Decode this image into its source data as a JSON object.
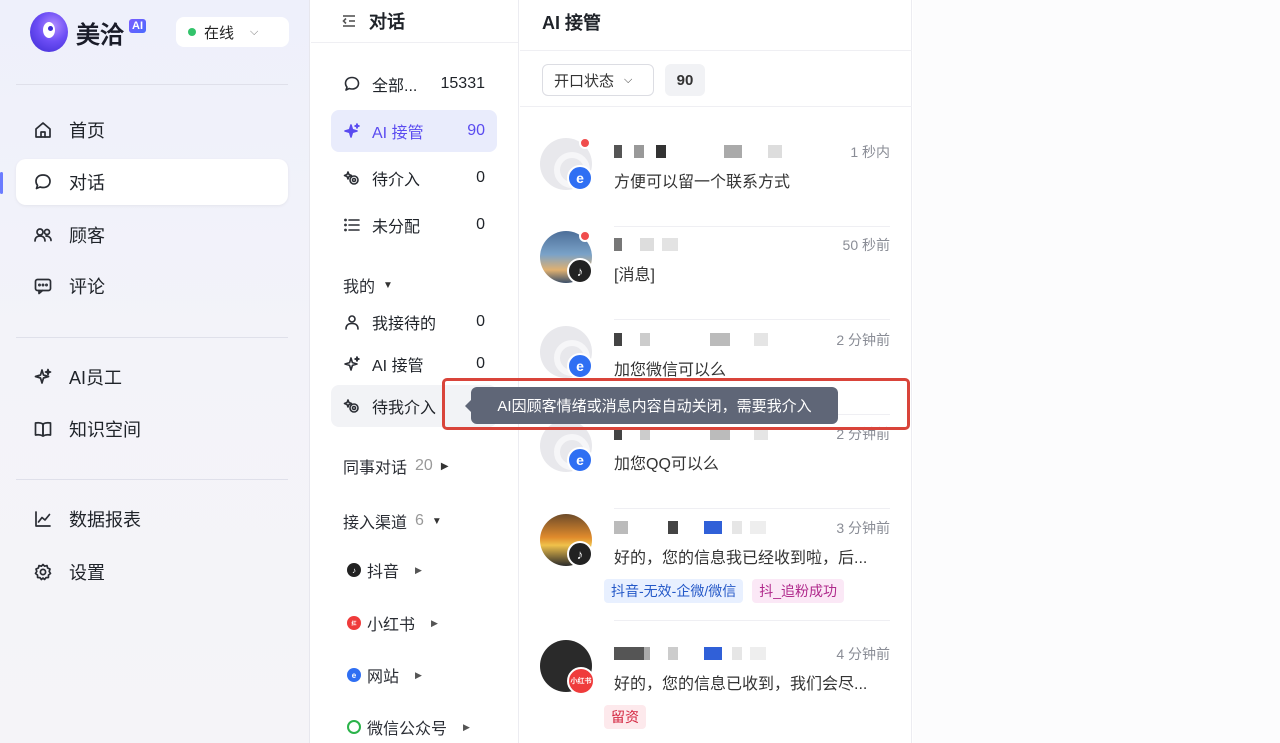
{
  "brand": {
    "name": "美洽",
    "ai_badge": "AI",
    "status": "在线"
  },
  "nav": {
    "items": [
      {
        "label": "首页",
        "icon": "home-icon"
      },
      {
        "label": "对话",
        "icon": "chat-bubble-icon"
      },
      {
        "label": "顾客",
        "icon": "people-icon"
      },
      {
        "label": "评论",
        "icon": "comment-icon"
      },
      {
        "label": "AI员工",
        "icon": "sparkle-icon"
      },
      {
        "label": "知识空间",
        "icon": "book-icon"
      },
      {
        "label": "数据报表",
        "icon": "chart-line-icon"
      },
      {
        "label": "设置",
        "icon": "gear-icon"
      }
    ]
  },
  "conv": {
    "title": "对话",
    "filters": [
      {
        "label": "全部...",
        "count": "15331"
      },
      {
        "label": "AI 接管",
        "count": "90"
      },
      {
        "label": "待介入",
        "count": "0"
      },
      {
        "label": "未分配",
        "count": "0"
      }
    ],
    "mine_label": "我的",
    "mine": [
      {
        "label": "我接待的",
        "count": "0"
      },
      {
        "label": "AI 接管",
        "count": "0"
      },
      {
        "label": "待我介入",
        "count": ""
      }
    ],
    "colleagues": {
      "label": "同事对话",
      "count": "20"
    },
    "channels": {
      "label": "接入渠道",
      "count": "6"
    },
    "channel_list": [
      {
        "label": "抖音"
      },
      {
        "label": "小红书"
      },
      {
        "label": "网站"
      },
      {
        "label": "微信公众号"
      }
    ]
  },
  "main": {
    "title": "AI 接管",
    "filter": {
      "label": "开口状态",
      "count": "90"
    },
    "rows": [
      {
        "time": "1 秒内",
        "msg": "方便可以留一个联系方式",
        "source": "web",
        "tags": []
      },
      {
        "time": "50 秒前",
        "msg": "[消息]",
        "source": "tiktok",
        "tags": []
      },
      {
        "time": "2 分钟前",
        "msg": "加您微信可以么",
        "source": "web",
        "tags": []
      },
      {
        "time": "2 分钟前",
        "msg": "加您QQ可以么",
        "source": "web",
        "tags": []
      },
      {
        "time": "3 分钟前",
        "msg": "好的，您的信息我已经收到啦，后...",
        "source": "tiktok",
        "tags": [
          "抖音-无效-企微/微信",
          "抖_追粉成功"
        ]
      },
      {
        "time": "4 分钟前",
        "msg": "好的，您的信息已收到，我们会尽...",
        "source": "xhs",
        "tags": [
          "留资"
        ]
      }
    ]
  },
  "tooltip": "AI因顾客情绪或消息内容自动关闭，需要我介入",
  "source_glyphs": {
    "web": "e",
    "tiktok": "♪",
    "xhs": "小红书"
  },
  "colors": {
    "accent": "#5a4bf0",
    "online": "#33c36b",
    "highlight": "#d9443a"
  }
}
